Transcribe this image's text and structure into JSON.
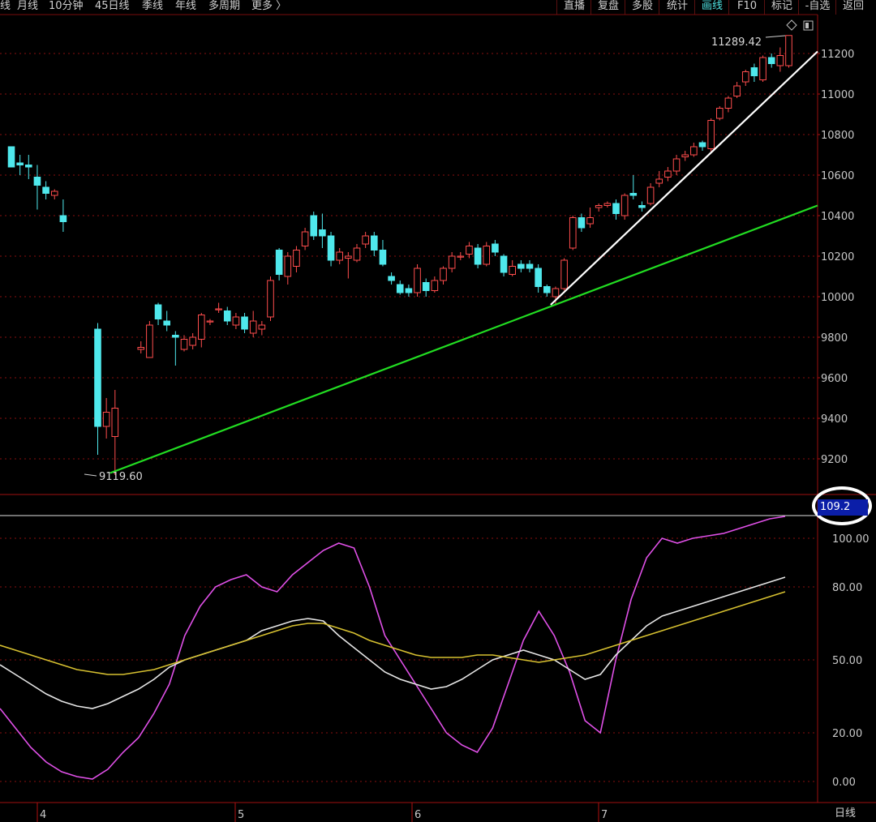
{
  "toolbar": {
    "periods": [
      "线",
      "月线",
      "10分钟",
      "45日线",
      "季线",
      "年线",
      "多周期",
      "更多 〉"
    ],
    "tabs": [
      "直播",
      "复盘",
      "多股",
      "统计",
      "画线",
      "F10",
      "标记",
      "-自选",
      "返回"
    ],
    "active_tab": "画线"
  },
  "colors": {
    "up": "#ff4d4d",
    "down": "#4fe8ec",
    "grid": "#8a0f0f",
    "trend_green": "#22dd22",
    "trend_white": "#ffffff",
    "k_line": "#e050e8",
    "d_line": "#e6e6e6",
    "j_line": "#d6c030",
    "accent_box": "#0b1ea8"
  },
  "chart_data": [
    {
      "type": "candlestick",
      "y_axis_ticks": [
        "9200",
        "9400",
        "9600",
        "9800",
        "10000",
        "10200",
        "10400",
        "10600",
        "10800",
        "11000",
        "11200"
      ],
      "ylim": [
        9040,
        11390
      ],
      "x_labels": [
        "4",
        "5",
        "6",
        "7"
      ],
      "annotations": {
        "low": "9119.60",
        "high": "11289.42"
      },
      "candles": [
        [
          10740,
          10640,
          10640,
          10740
        ],
        [
          10660,
          10650,
          10600,
          10700
        ],
        [
          10650,
          10640,
          10580,
          10700
        ],
        [
          10590,
          10550,
          10430,
          10650
        ],
        [
          10540,
          10510,
          10480,
          10570
        ],
        [
          10500,
          10520,
          10480,
          10530
        ],
        [
          10400,
          10370,
          10320,
          10480
        ],
        null,
        null,
        null,
        [
          9840,
          9360,
          9220,
          9870
        ],
        [
          9360,
          9430,
          9300,
          9500
        ],
        [
          9310,
          9450,
          9120,
          9540
        ],
        null,
        null,
        [
          9740,
          9750,
          9720,
          9780
        ],
        [
          9700,
          9860,
          9700,
          9880
        ],
        [
          9960,
          9890,
          9860,
          9970
        ],
        [
          9880,
          9860,
          9830,
          9930
        ],
        [
          9810,
          9800,
          9660,
          9830
        ],
        [
          9740,
          9790,
          9730,
          9810
        ],
        [
          9760,
          9800,
          9740,
          9820
        ],
        [
          9790,
          9910,
          9750,
          9920
        ],
        [
          9880,
          9880,
          9860,
          9890
        ],
        [
          9940,
          9940,
          9920,
          9970
        ],
        [
          9930,
          9880,
          9860,
          9950
        ],
        [
          9860,
          9900,
          9840,
          9920
        ],
        [
          9900,
          9840,
          9820,
          9920
        ],
        [
          9820,
          9880,
          9800,
          9930
        ],
        [
          9840,
          9860,
          9810,
          9880
        ],
        [
          9900,
          10080,
          9880,
          10100
        ],
        [
          10230,
          10110,
          10080,
          10240
        ],
        [
          10100,
          10200,
          10060,
          10220
        ],
        [
          10150,
          10230,
          10120,
          10250
        ],
        [
          10250,
          10320,
          10230,
          10340
        ],
        [
          10400,
          10300,
          10280,
          10420
        ],
        [
          10330,
          10300,
          10240,
          10410
        ],
        [
          10300,
          10180,
          10150,
          10320
        ],
        [
          10180,
          10220,
          10160,
          10240
        ],
        [
          10190,
          10200,
          10090,
          10220
        ],
        [
          10180,
          10240,
          10170,
          10260
        ],
        [
          10260,
          10300,
          10240,
          10320
        ],
        [
          10300,
          10230,
          10200,
          10320
        ],
        [
          10230,
          10160,
          10150,
          10280
        ],
        [
          10100,
          10080,
          10060,
          10120
        ],
        [
          10060,
          10020,
          10010,
          10080
        ],
        [
          10040,
          10020,
          10000,
          10060
        ],
        [
          10020,
          10140,
          10000,
          10160
        ],
        [
          10070,
          10030,
          10000,
          10090
        ],
        [
          10030,
          10080,
          10020,
          10100
        ],
        [
          10080,
          10140,
          10060,
          10150
        ],
        [
          10140,
          10200,
          10120,
          10220
        ],
        [
          10200,
          10200,
          10180,
          10220
        ],
        [
          10210,
          10250,
          10190,
          10270
        ],
        [
          10240,
          10160,
          10140,
          10260
        ],
        [
          10160,
          10250,
          10150,
          10270
        ],
        [
          10260,
          10220,
          10200,
          10280
        ],
        [
          10200,
          10120,
          10100,
          10210
        ],
        [
          10110,
          10150,
          10100,
          10180
        ],
        [
          10160,
          10140,
          10120,
          10180
        ],
        [
          10160,
          10140,
          10120,
          10180
        ],
        [
          10140,
          10050,
          10020,
          10160
        ],
        [
          10050,
          10020,
          10000,
          10060
        ],
        [
          10000,
          10040,
          9960,
          10050
        ],
        [
          10040,
          10180,
          10030,
          10190
        ],
        [
          10240,
          10390,
          10230,
          10400
        ],
        [
          10390,
          10340,
          10320,
          10410
        ],
        [
          10360,
          10390,
          10340,
          10440
        ],
        [
          10440,
          10450,
          10420,
          10460
        ],
        [
          10450,
          10460,
          10440,
          10470
        ],
        [
          10460,
          10410,
          10380,
          10480
        ],
        [
          10400,
          10500,
          10380,
          10510
        ],
        [
          10510,
          10500,
          10480,
          10600
        ],
        [
          10450,
          10440,
          10420,
          10470
        ],
        [
          10460,
          10540,
          10450,
          10560
        ],
        [
          10560,
          10580,
          10540,
          10620
        ],
        [
          10590,
          10620,
          10570,
          10640
        ],
        [
          10620,
          10680,
          10600,
          10700
        ],
        [
          10690,
          10700,
          10670,
          10720
        ],
        [
          10700,
          10740,
          10690,
          10760
        ],
        [
          10760,
          10740,
          10720,
          10770
        ],
        [
          10730,
          10870,
          10710,
          10880
        ],
        [
          10880,
          10930,
          10870,
          10940
        ],
        [
          10930,
          10980,
          10910,
          10990
        ],
        [
          10990,
          11040,
          10980,
          11060
        ],
        [
          11060,
          11110,
          11040,
          11120
        ],
        [
          11130,
          11090,
          11060,
          11150
        ],
        [
          11070,
          11180,
          11060,
          11190
        ],
        [
          11180,
          11150,
          11130,
          11200
        ],
        [
          11140,
          11190,
          11110,
          11230
        ],
        [
          11140,
          11289,
          11130,
          11289
        ]
      ],
      "trendlines": [
        {
          "from": [
            12,
            9130
          ],
          "to": [
            84,
            10450
          ],
          "color": "green"
        },
        {
          "from": [
            63,
            9960
          ],
          "to": [
            89,
            11210
          ],
          "color": "white"
        }
      ]
    },
    {
      "type": "line",
      "current_value": "109.2",
      "y_axis_ticks": [
        "0.00",
        "20.00",
        "50.00",
        "80.00",
        "100.00"
      ],
      "x_labels": [
        "4",
        "5",
        "6",
        "7"
      ],
      "series": [
        {
          "color": "magenta",
          "values": [
            30,
            22,
            14,
            8,
            4,
            2,
            1,
            5,
            12,
            18,
            28,
            40,
            60,
            72,
            80,
            83,
            85,
            80,
            78,
            85,
            90,
            95,
            98,
            96,
            80,
            60,
            50,
            40,
            30,
            20,
            15,
            12,
            22,
            40,
            58,
            70,
            60,
            45,
            25,
            20,
            50,
            75,
            92,
            100,
            98,
            100,
            101,
            102,
            104,
            106,
            108,
            109.2
          ]
        },
        {
          "color": "white",
          "values": [
            48,
            44,
            40,
            36,
            33,
            31,
            30,
            32,
            35,
            38,
            42,
            47,
            50,
            52,
            54,
            56,
            58,
            62,
            64,
            66,
            67,
            66,
            60,
            55,
            50,
            45,
            42,
            40,
            38,
            39,
            42,
            46,
            50,
            52,
            54,
            52,
            50,
            46,
            42,
            44,
            52,
            58,
            64,
            68,
            70,
            72,
            74,
            76,
            78,
            80,
            82,
            84
          ]
        },
        {
          "color": "yellow",
          "values": [
            56,
            54,
            52,
            50,
            48,
            46,
            45,
            44,
            44,
            45,
            46,
            48,
            50,
            52,
            54,
            56,
            58,
            60,
            62,
            64,
            65,
            65,
            63,
            61,
            58,
            56,
            54,
            52,
            51,
            51,
            51,
            52,
            52,
            51,
            50,
            49,
            50,
            51,
            52,
            54,
            56,
            58,
            60,
            62,
            64,
            66,
            68,
            70,
            72,
            74,
            76,
            78
          ]
        }
      ]
    }
  ],
  "status": {
    "period_label": "日线"
  }
}
